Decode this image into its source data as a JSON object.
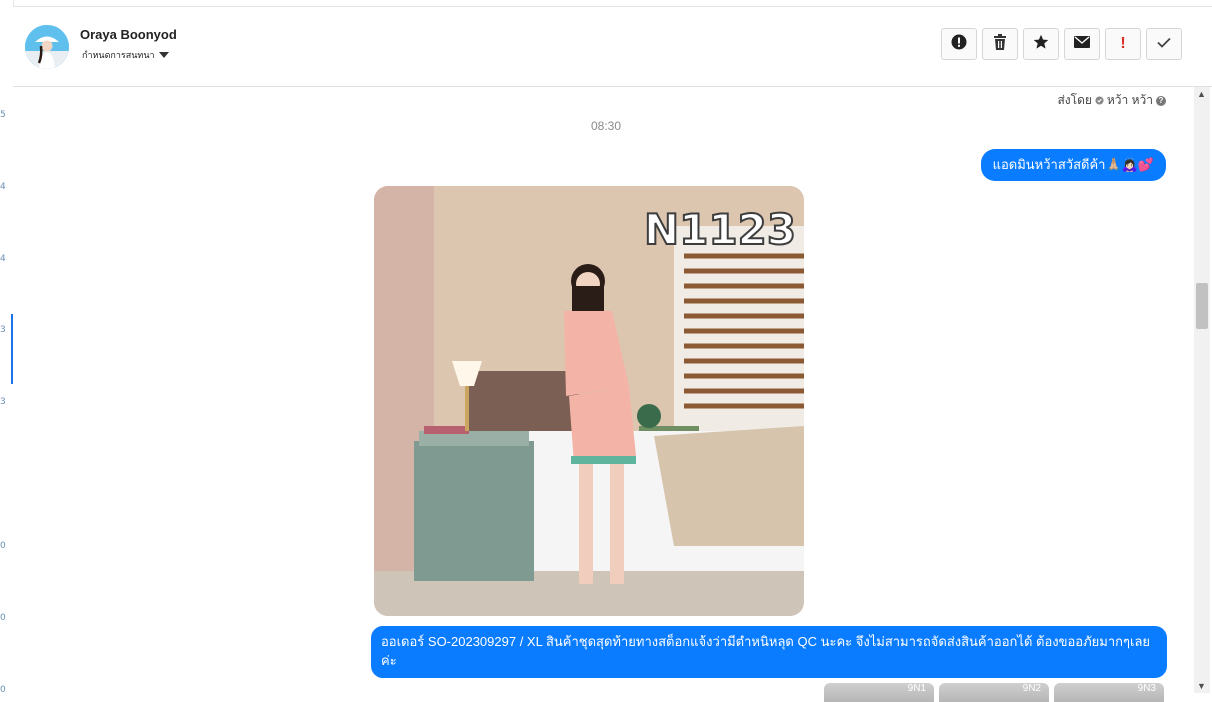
{
  "contact": {
    "name": "Oraya Boonyod",
    "subtitle": "กำหนดการสนทนา"
  },
  "header_actions": [
    {
      "icon": "alert-circle-icon"
    },
    {
      "icon": "trash-icon"
    },
    {
      "icon": "star-icon"
    },
    {
      "icon": "mail-icon"
    },
    {
      "icon": "exclamation-icon"
    },
    {
      "icon": "check-icon"
    }
  ],
  "chat": {
    "sent_by_label": "ส่งโดย",
    "sent_by_name": "หว้า หว้า",
    "timestamp": "08:30",
    "messages": [
      {
        "text": "แอดมินหว้าสวัสดีค้า🙏🏼🙇🏻‍♀️💕"
      },
      {
        "image_text": "N1123"
      },
      {
        "text": "ออเดอร์ SO-202309297 / XL สินค้าชุดสุดท้ายทางสต็อกแจ้งว่ามีตำหนิหลุด QC นะคะ จึงไม่สามารถจัดส่งสินค้าออกได้ ต้องขออภัยมากๆเลยค่ะ"
      }
    ],
    "thumbnails": [
      {
        "label": "9N1"
      },
      {
        "label": "9N2"
      },
      {
        "label": "9N3"
      }
    ]
  },
  "colors": {
    "bubble": "#0a7cff",
    "accent": "#1a73e8",
    "exclamation": "#d93025"
  }
}
